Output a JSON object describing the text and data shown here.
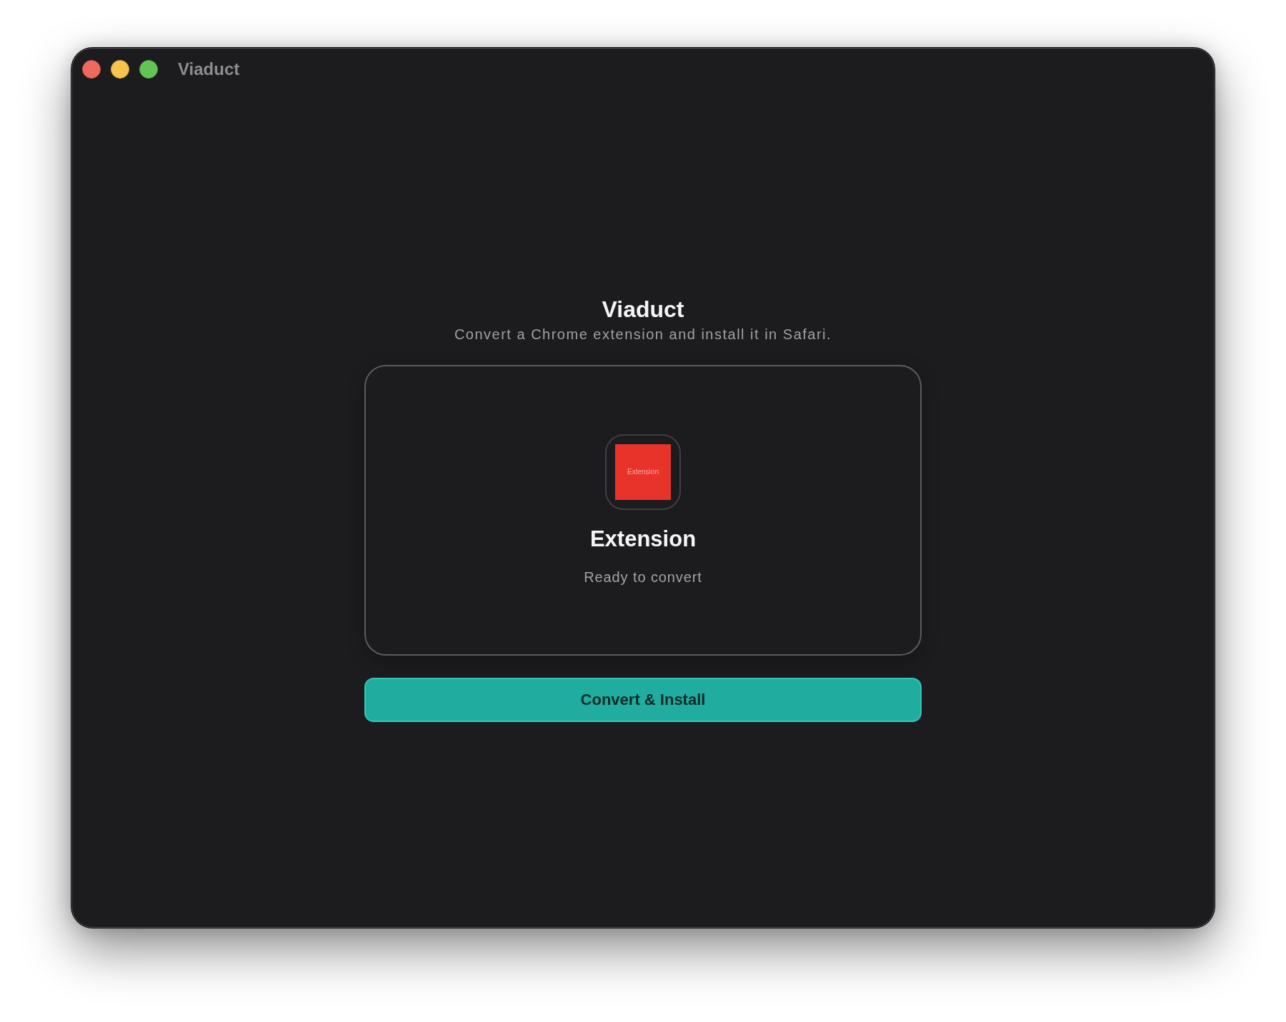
{
  "window": {
    "title": "Viaduct"
  },
  "header": {
    "title": "Viaduct",
    "subtitle": "Convert a Chrome extension and install it in Safari."
  },
  "card": {
    "image_label": "Extension",
    "name": "Extension",
    "status": "Ready to convert"
  },
  "primary_button": {
    "label": "Convert & Install"
  }
}
